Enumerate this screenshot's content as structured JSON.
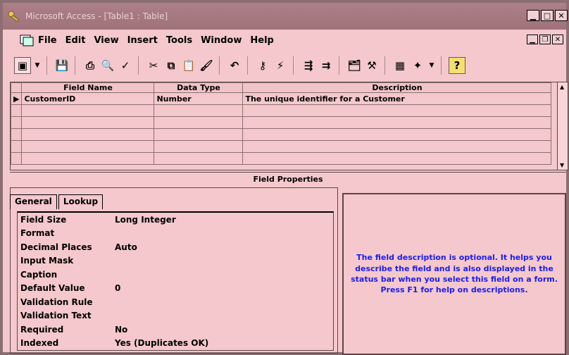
{
  "window": {
    "title": "Microsoft Access - [Table1 : Table]"
  },
  "menubar": {
    "items": [
      "File",
      "Edit",
      "View",
      "Insert",
      "Tools",
      "Window",
      "Help"
    ]
  },
  "toolbar": {
    "icons": [
      "view-icon",
      "dropdown-icon",
      "save-icon",
      "print-icon",
      "print-preview-icon",
      "spelling-icon",
      "cut-icon",
      "copy-icon",
      "paste-icon",
      "format-painter-icon",
      "undo-icon",
      "primary-key-icon",
      "indexes-icon",
      "insert-rows-icon",
      "delete-rows-icon",
      "properties-icon",
      "build-icon",
      "database-window-icon",
      "new-object-icon",
      "help-icon"
    ]
  },
  "grid": {
    "headers": [
      "Field Name",
      "Data Type",
      "Description"
    ],
    "rows": [
      {
        "field_name": "CustomerID",
        "data_type": "Number",
        "description": "The unique identifier for a Customer"
      },
      {
        "field_name": "",
        "data_type": "",
        "description": ""
      },
      {
        "field_name": "",
        "data_type": "",
        "description": ""
      },
      {
        "field_name": "",
        "data_type": "",
        "description": ""
      },
      {
        "field_name": "",
        "data_type": "",
        "description": ""
      },
      {
        "field_name": "",
        "data_type": "",
        "description": ""
      }
    ]
  },
  "field_properties": {
    "label": "Field Properties",
    "tabs": [
      "General",
      "Lookup"
    ],
    "active_tab": "General",
    "properties": [
      {
        "label": "Field Size",
        "value": "Long Integer"
      },
      {
        "label": "Format",
        "value": ""
      },
      {
        "label": "Decimal Places",
        "value": "Auto"
      },
      {
        "label": "Input Mask",
        "value": ""
      },
      {
        "label": "Caption",
        "value": ""
      },
      {
        "label": "Default Value",
        "value": "0"
      },
      {
        "label": "Validation Rule",
        "value": ""
      },
      {
        "label": "Validation Text",
        "value": ""
      },
      {
        "label": "Required",
        "value": "No"
      },
      {
        "label": "Indexed",
        "value": "Yes (Duplicates OK)"
      }
    ],
    "help_text": "The field description is optional.  It helps you describe the field and is also displayed in the status bar when you select this field on a form.  Press F1 for help on descriptions."
  },
  "colors": {
    "background": "#f4c8cc",
    "titlebar": "#a57a80",
    "help_text": "#1c1cf0"
  }
}
